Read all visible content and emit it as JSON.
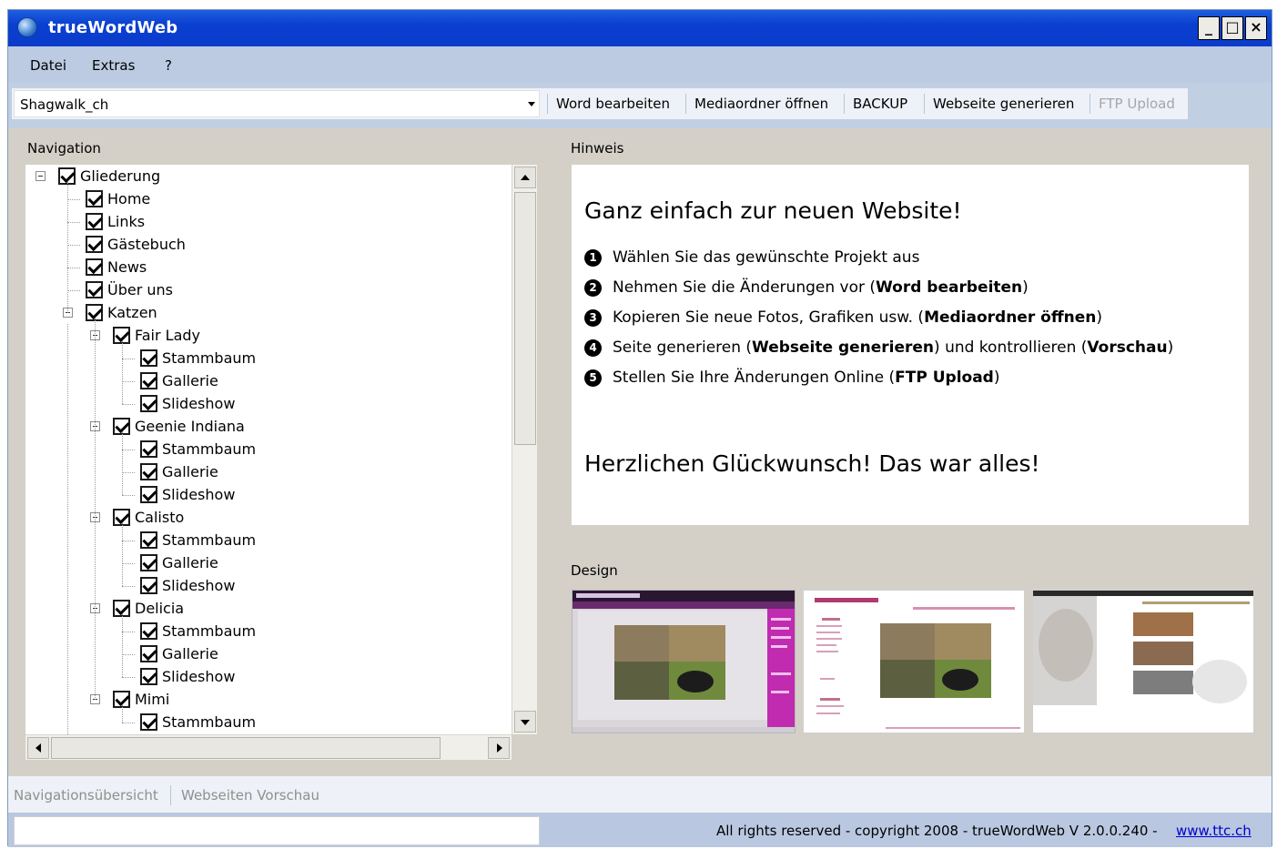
{
  "window": {
    "title": "trueWordWeb",
    "controls": {
      "minimize": "_",
      "maximize": "□",
      "close": "×"
    }
  },
  "menu": {
    "items": [
      "Datei",
      "Extras",
      "?"
    ]
  },
  "toolbar": {
    "project_select_value": "Shagwalk_ch",
    "buttons": {
      "word_bearbeiten": "Word bearbeiten",
      "mediaordner_oeffnen": "Mediaordner öffnen",
      "backup": "BACKUP",
      "webseite_generieren": "Webseite generieren",
      "ftp_upload": "FTP Upload"
    }
  },
  "navigation": {
    "label": "Navigation",
    "tree": [
      {
        "label": "Gliederung",
        "level": 0,
        "expander": true
      },
      {
        "label": "Home",
        "level": 1,
        "expander": false
      },
      {
        "label": "Links",
        "level": 1,
        "expander": false
      },
      {
        "label": "Gästebuch",
        "level": 1,
        "expander": false
      },
      {
        "label": "News",
        "level": 1,
        "expander": false
      },
      {
        "label": "Über uns",
        "level": 1,
        "expander": false
      },
      {
        "label": "Katzen",
        "level": 1,
        "expander": true
      },
      {
        "label": "Fair Lady",
        "level": 2,
        "expander": true
      },
      {
        "label": "Stammbaum",
        "level": 3,
        "expander": false
      },
      {
        "label": "Gallerie",
        "level": 3,
        "expander": false
      },
      {
        "label": "Slideshow",
        "level": 3,
        "expander": false
      },
      {
        "label": "Geenie Indiana",
        "level": 2,
        "expander": true
      },
      {
        "label": "Stammbaum",
        "level": 3,
        "expander": false
      },
      {
        "label": "Gallerie",
        "level": 3,
        "expander": false
      },
      {
        "label": "Slideshow",
        "level": 3,
        "expander": false
      },
      {
        "label": "Calisto",
        "level": 2,
        "expander": true
      },
      {
        "label": "Stammbaum",
        "level": 3,
        "expander": false
      },
      {
        "label": "Gallerie",
        "level": 3,
        "expander": false
      },
      {
        "label": "Slideshow",
        "level": 3,
        "expander": false
      },
      {
        "label": "Delicia",
        "level": 2,
        "expander": true
      },
      {
        "label": "Stammbaum",
        "level": 3,
        "expander": false
      },
      {
        "label": "Gallerie",
        "level": 3,
        "expander": false
      },
      {
        "label": "Slideshow",
        "level": 3,
        "expander": false
      },
      {
        "label": "Mimi",
        "level": 2,
        "expander": true
      },
      {
        "label": "Stammbaum",
        "level": 3,
        "expander": false
      }
    ]
  },
  "hint": {
    "label": "Hinweis",
    "title": "Ganz einfach zur neuen Website!",
    "steps": [
      {
        "num": "1",
        "parts": [
          {
            "t": "Wählen Sie das gewünschte Projekt aus",
            "b": false
          }
        ]
      },
      {
        "num": "2",
        "parts": [
          {
            "t": "Nehmen Sie die Änderungen vor (",
            "b": false
          },
          {
            "t": "Word bearbeiten",
            "b": true
          },
          {
            "t": ")",
            "b": false
          }
        ]
      },
      {
        "num": "3",
        "parts": [
          {
            "t": "Kopieren Sie neue Fotos, Grafiken usw. (",
            "b": false
          },
          {
            "t": "Mediaordner öffnen",
            "b": true
          },
          {
            "t": ")",
            "b": false
          }
        ]
      },
      {
        "num": "4",
        "parts": [
          {
            "t": "Seite generieren (",
            "b": false
          },
          {
            "t": "Webseite generieren",
            "b": true
          },
          {
            "t": ") und kontrollieren (",
            "b": false
          },
          {
            "t": "Vorschau",
            "b": true
          },
          {
            "t": ")",
            "b": false
          }
        ]
      },
      {
        "num": "5",
        "parts": [
          {
            "t": "Stellen Sie Ihre Änderungen Online (",
            "b": false
          },
          {
            "t": "FTP Upload",
            "b": true
          },
          {
            "t": ")",
            "b": false
          }
        ]
      }
    ],
    "congrats": "Herzlichen Glückwunsch! Das war alles!"
  },
  "design": {
    "label": "Design"
  },
  "bottom_tabs": {
    "overview": "Navigationsübersicht",
    "preview": "Webseiten Vorschau"
  },
  "status": {
    "copyright": "All rights reserved - copyright 2008 - trueWordWeb V 2.0.0.240 -",
    "link": "www.ttc.ch"
  },
  "colors": {
    "titlebar": "#0a3fd0",
    "menubar": "#bccbe2",
    "toolbar": "#c1cfe3",
    "statusbar": "#b9c8e0",
    "panel_bg": "#d4d0c8",
    "link": "#0000cc",
    "design1_accent": "#c02bb0"
  }
}
